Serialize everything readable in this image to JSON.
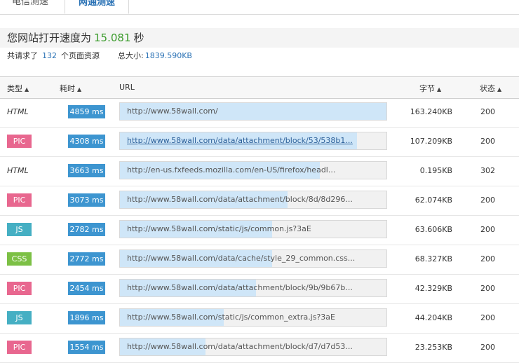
{
  "tabs": [
    {
      "label": "电信测速",
      "active": false
    },
    {
      "label": "网通测速",
      "active": true
    }
  ],
  "summary": {
    "prefix": "您网站打开速度为",
    "speed": "15.081",
    "unit": "秒"
  },
  "stats": {
    "requested_label": "共请求了",
    "count": "132",
    "count_suffix": "个页面资源",
    "size_label": "总大小:",
    "size_value": "1839.590KB"
  },
  "columns": {
    "type": "类型",
    "time": "耗时",
    "url": "URL",
    "bytes": "字节",
    "status": "状态"
  },
  "colors": {
    "PIC": "#e8678f",
    "JS": "#45afc3",
    "CSS": "#7cc045",
    "time_badge": "#3d95d0",
    "url_fill": "#cfe6f8"
  },
  "rows": [
    {
      "type": "HTML",
      "time": "4859 ms",
      "url": "http://www.58wall.com/",
      "url_link": false,
      "progress": 1.0,
      "bytes": "163.240KB",
      "status": "200"
    },
    {
      "type": "PIC",
      "time": "4308 ms",
      "url": "http://www.58wall.com/data/attachment/block/53/538b1...",
      "url_link": true,
      "progress": 0.89,
      "bytes": "107.209KB",
      "status": "200"
    },
    {
      "type": "HTML",
      "time": "3663 ms",
      "url": "http://en-us.fxfeeds.mozilla.com/en-US/firefox/headl...",
      "url_link": false,
      "progress": 0.75,
      "bytes": "0.195KB",
      "status": "302"
    },
    {
      "type": "PIC",
      "time": "3073 ms",
      "url": "http://www.58wall.com/data/attachment/block/8d/8d296...",
      "url_link": false,
      "progress": 0.63,
      "bytes": "62.074KB",
      "status": "200"
    },
    {
      "type": "JS",
      "time": "2782 ms",
      "url": "http://www.58wall.com/static/js/common.js?3aE",
      "url_link": false,
      "progress": 0.57,
      "bytes": "63.606KB",
      "status": "200"
    },
    {
      "type": "CSS",
      "time": "2772 ms",
      "url": "http://www.58wall.com/data/cache/style_29_common.css...",
      "url_link": false,
      "progress": 0.57,
      "bytes": "68.327KB",
      "status": "200"
    },
    {
      "type": "PIC",
      "time": "2454 ms",
      "url": "http://www.58wall.com/data/attachment/block/9b/9b67b...",
      "url_link": false,
      "progress": 0.51,
      "bytes": "42.329KB",
      "status": "200"
    },
    {
      "type": "JS",
      "time": "1896 ms",
      "url": "http://www.58wall.com/static/js/common_extra.js?3aE",
      "url_link": false,
      "progress": 0.39,
      "bytes": "44.204KB",
      "status": "200"
    },
    {
      "type": "PIC",
      "time": "1554 ms",
      "url": "http://www.58wall.com/data/attachment/block/d7/d7d53...",
      "url_link": false,
      "progress": 0.32,
      "bytes": "23.253KB",
      "status": "200"
    }
  ]
}
